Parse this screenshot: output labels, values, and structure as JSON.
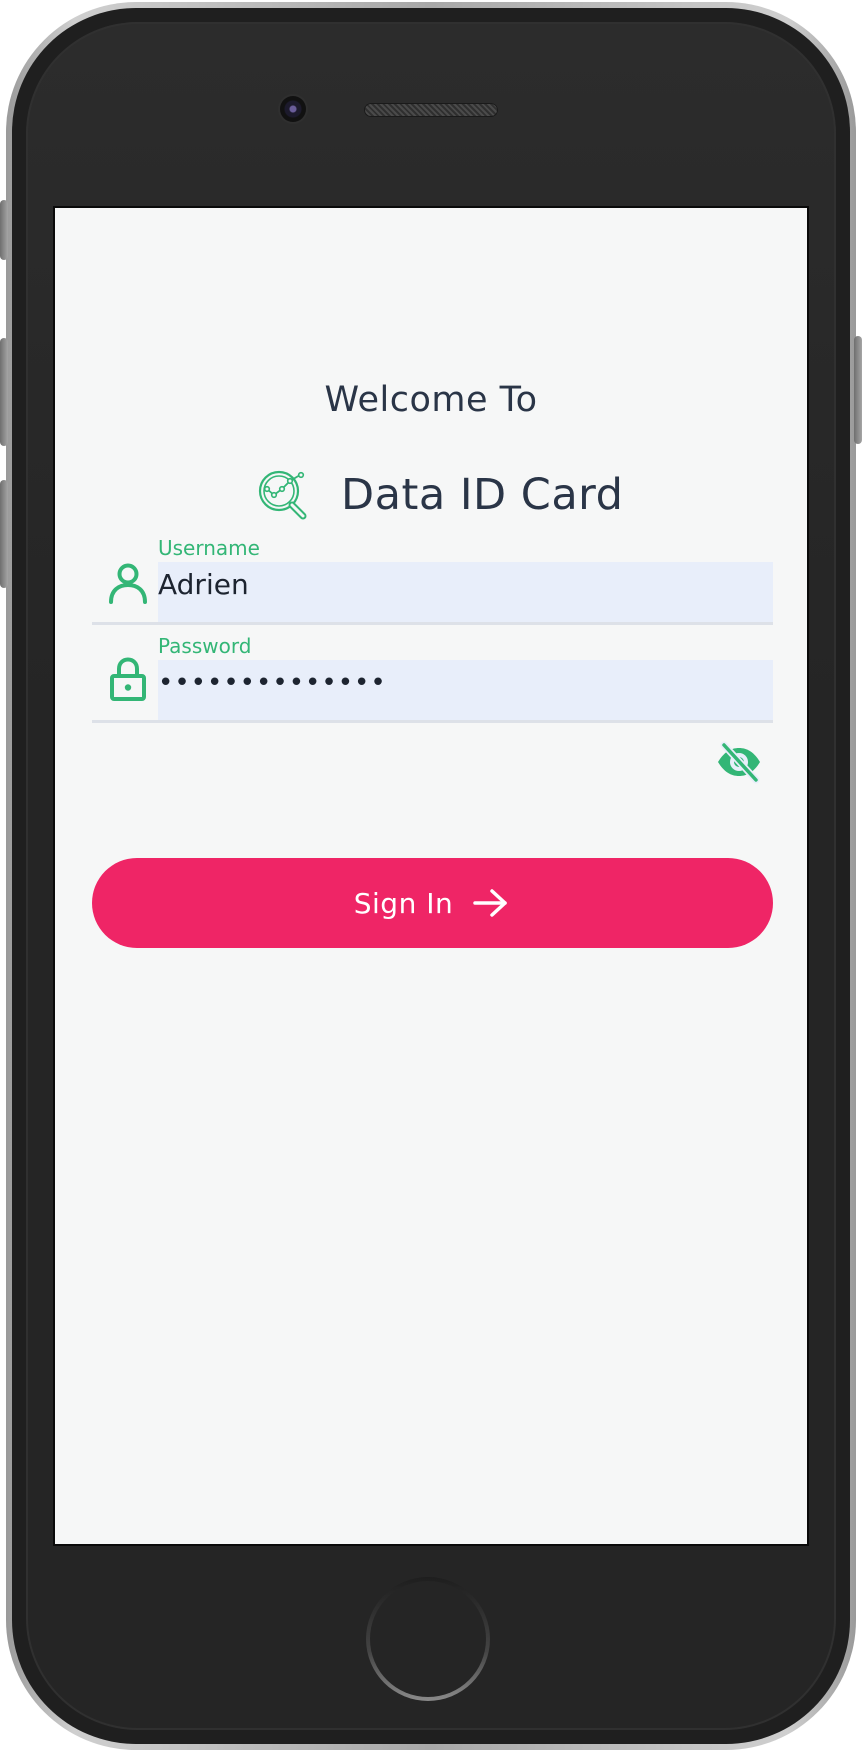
{
  "header": {
    "welcome": "Welcome To",
    "app_name": "Data ID Card"
  },
  "login": {
    "username": {
      "label": "Username",
      "value": "Adrien"
    },
    "password": {
      "label": "Password",
      "masked_value": "••••••••••••••"
    },
    "submit_label": "Sign In"
  },
  "icons": {
    "brand": "analytics-magnifier-icon",
    "username": "user-icon",
    "password": "lock-icon",
    "password_toggle": "eye-slash-icon",
    "submit": "arrow-right-icon"
  },
  "colors": {
    "accent_green": "#33b676",
    "primary_button": "#ef2566",
    "text_dark": "#2a3547",
    "input_background": "#e8eefa",
    "screen_background": "#f6f7f7"
  }
}
